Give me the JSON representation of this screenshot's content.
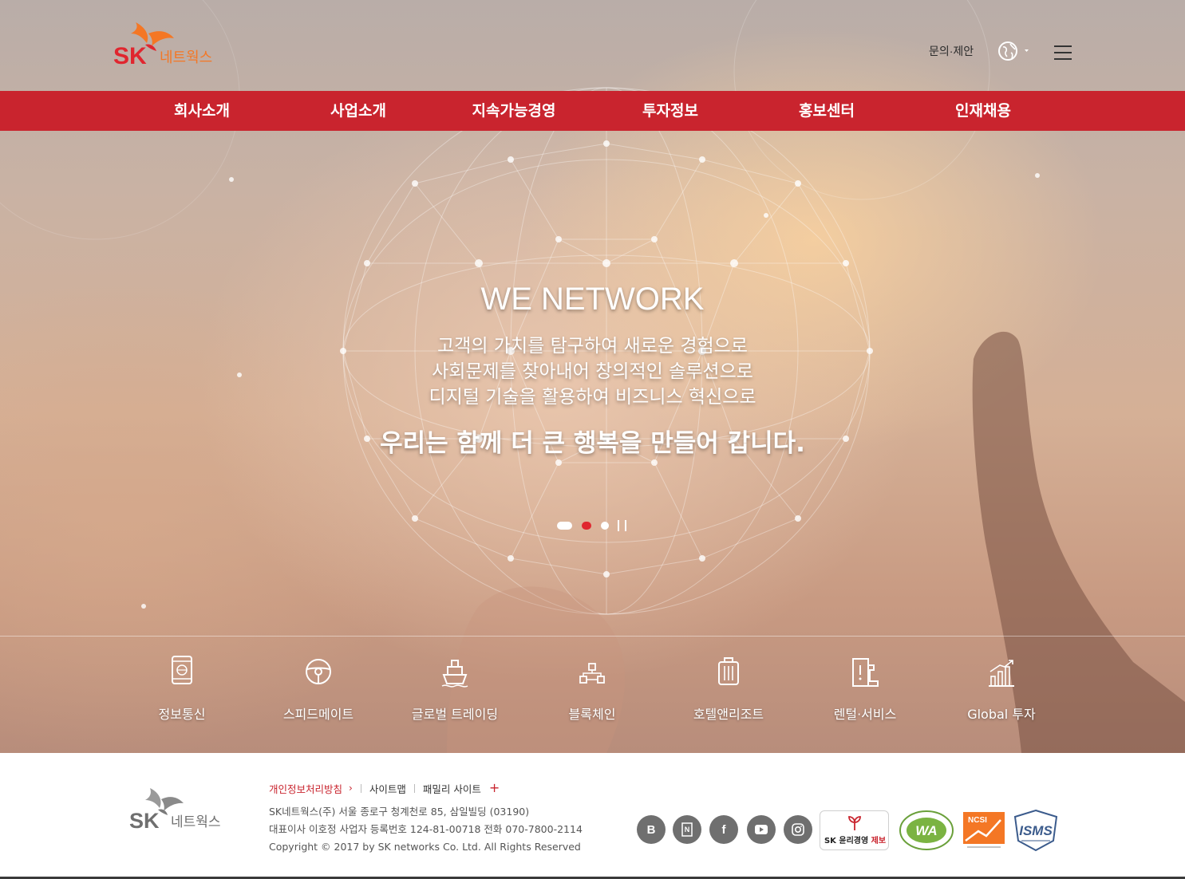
{
  "header": {
    "logo_text": "SK 네트웍스",
    "inquiry_label": "문의·제안",
    "language_icon": "globe-icon",
    "menu_icon": "hamburger-icon"
  },
  "gnb": {
    "items": [
      "회사소개",
      "사업소개",
      "지속가능경영",
      "투자정보",
      "홍보센터",
      "인재채용"
    ]
  },
  "hero": {
    "title": "WE NETWORK",
    "lines": [
      "고객의 가치를 탐구하여 새로운 경험으로",
      "사회문제를 찾아내어 창의적인 솔루션으로",
      "디지털 기술을 활용하여 비즈니스 혁신으로"
    ],
    "headline": "우리는 함께 더 큰 행복을 만들어 갑니다.",
    "slide_count": 3,
    "active_slide": 2
  },
  "business": {
    "items": [
      {
        "label": "정보통신",
        "icon": "smartphone-icon"
      },
      {
        "label": "스피드메이트",
        "icon": "steering-wheel-icon"
      },
      {
        "label": "글로벌 트레이딩",
        "icon": "ship-icon"
      },
      {
        "label": "블록체인",
        "icon": "blockchain-icon"
      },
      {
        "label": "호텔앤리조트",
        "icon": "luggage-icon"
      },
      {
        "label": "렌털·서비스",
        "icon": "rental-icon"
      },
      {
        "label": "Global 투자",
        "icon": "bar-chart-icon"
      }
    ]
  },
  "footer": {
    "logo_text": "SK 네트웍스",
    "links": {
      "privacy": "개인정보처리방침",
      "sitemap": "사이트맵",
      "family": "패밀리 사이트"
    },
    "address": "SK네트웍스(주) 서울 종로구 청계천로 85, 삼일빌딩 (03190)",
    "ceo_info": "대표이사 이호정 사업자 등록번호 124-81-00718 전화 070-7800-2114",
    "copyright": "Copyright © 2017 by SK networks Co. Ltd. All Rights Reserved",
    "social": [
      {
        "label": "B",
        "icon": "blog-icon"
      },
      {
        "label": "N",
        "icon": "naver-post-icon"
      },
      {
        "label": "f",
        "icon": "facebook-icon"
      },
      {
        "label": "",
        "icon": "youtube-icon"
      },
      {
        "label": "",
        "icon": "instagram-icon"
      }
    ],
    "ethics_badge": {
      "prefix": "SK 윤리경영 ",
      "suffix": "제보"
    },
    "badges": {
      "wa": "WA",
      "ncsi": "NCSI",
      "isms": "ISMS"
    }
  },
  "colors": {
    "brand_red": "#c9242e",
    "brand_orange": "#f47725"
  }
}
